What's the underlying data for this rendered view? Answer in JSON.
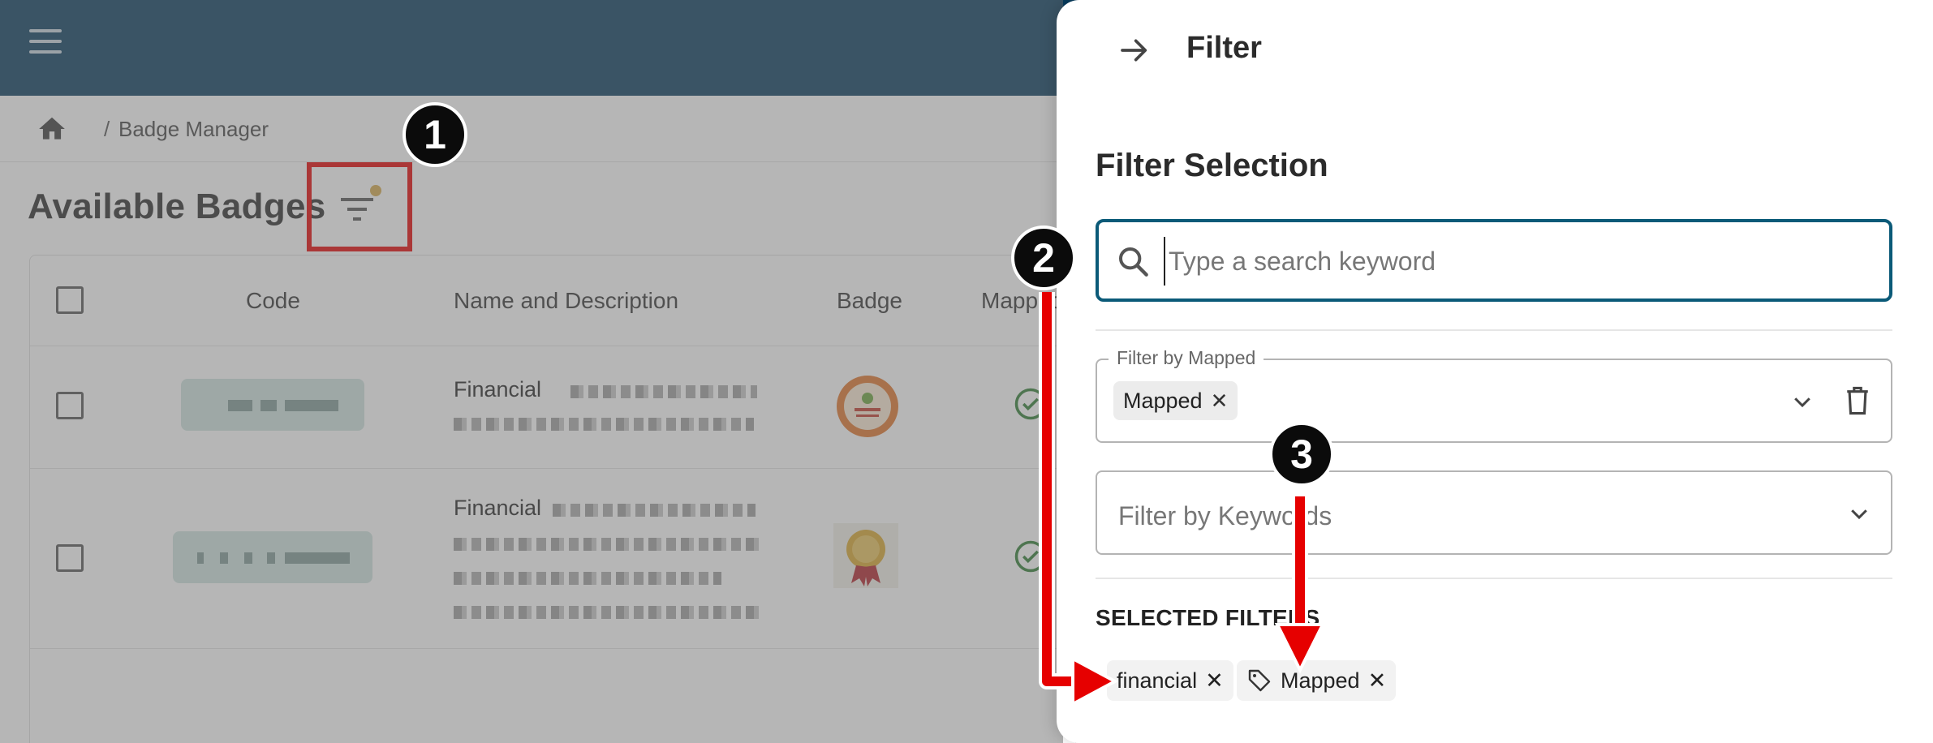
{
  "breadcrumb": {
    "separator": "/",
    "current": "Badge Manager"
  },
  "page": {
    "title": "Available Badges"
  },
  "table": {
    "columns": [
      "Code",
      "Name and Description",
      "Badge",
      "Mapped"
    ],
    "rows": [
      {
        "name_visible": "Financial",
        "mapped": true
      },
      {
        "name_visible": "Financial",
        "mapped": true
      }
    ]
  },
  "drawer": {
    "title": "Filter",
    "section_title": "Filter Selection",
    "search_placeholder": "Type a search keyword",
    "mapped_filter": {
      "legend": "Filter by Mapped",
      "chip": "Mapped",
      "chip_remove": "✕"
    },
    "keywords_filter": {
      "placeholder": "Filter by Keywords"
    },
    "selected_title": "SELECTED FILTERS",
    "selected_filters": [
      {
        "label": "financial",
        "remove": "✕",
        "icon": "none"
      },
      {
        "label": "Mapped",
        "remove": "✕",
        "icon": "tag-icon"
      }
    ]
  },
  "annotations": {
    "callout_1": "1",
    "callout_2": "2",
    "callout_3": "3"
  },
  "colors": {
    "topbar": "#073b5c",
    "accent": "#0b5a78",
    "highlight": "#e60000",
    "dot": "#d4a84b"
  }
}
